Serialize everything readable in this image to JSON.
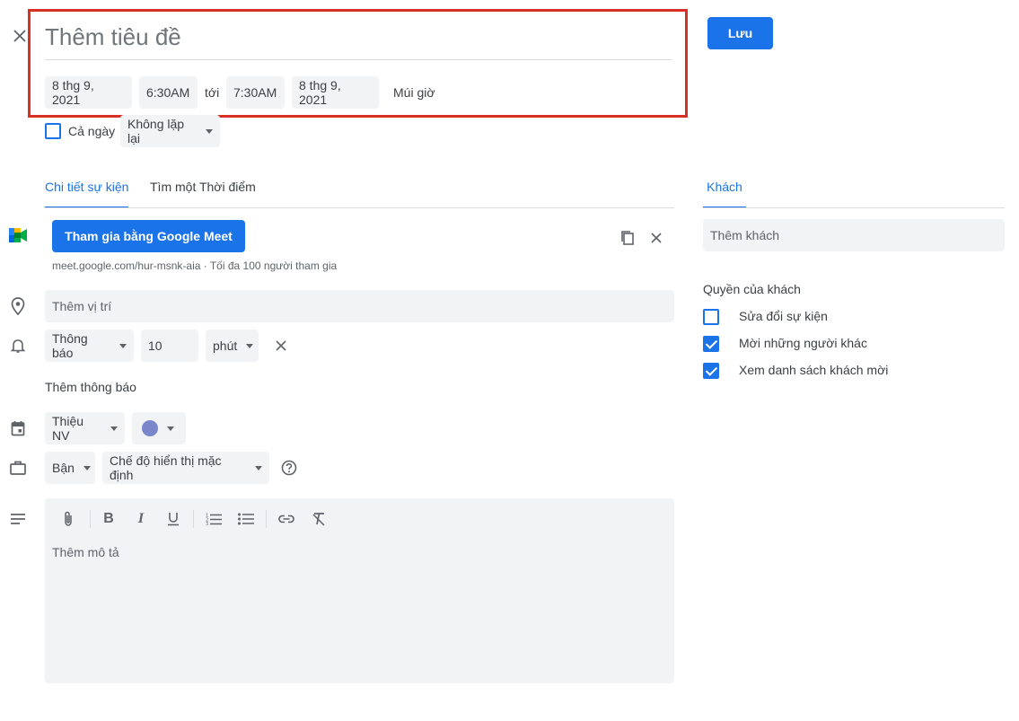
{
  "header": {
    "close_icon": "close-icon",
    "title_placeholder": "Thêm tiêu đề",
    "save_label": "Lưu"
  },
  "datetime": {
    "start_date": "8 thg 9, 2021",
    "start_time": "6:30AM",
    "to_label": "tới",
    "end_time": "7:30AM",
    "end_date": "8 thg 9, 2021",
    "timezone_label": "Múi giờ"
  },
  "options": {
    "all_day_label": "Cả ngày",
    "all_day_checked": false,
    "repeat_value": "Không lặp lại"
  },
  "tabs": {
    "details": "Chi tiết sự kiện",
    "find_time": "Tìm một Thời điểm",
    "active": "details"
  },
  "meet": {
    "join_label": "Tham gia bằng Google Meet",
    "info": "meet.google.com/hur-msnk-aia · Tối đa 100 người tham gia"
  },
  "location": {
    "placeholder": "Thêm vị trí"
  },
  "notification": {
    "type": "Thông báo",
    "amount": "10",
    "unit": "phút",
    "add_label": "Thêm thông báo"
  },
  "calendar": {
    "name": "Thiệu NV",
    "color": "#7986cb"
  },
  "availability": {
    "status": "Bận",
    "visibility": "Chế độ hiển thị mặc định"
  },
  "description": {
    "placeholder": "Thêm mô tả"
  },
  "guests": {
    "tab_label": "Khách",
    "add_placeholder": "Thêm khách",
    "permissions_title": "Quyền của khách",
    "permissions": [
      {
        "label": "Sửa đổi sự kiện",
        "checked": false
      },
      {
        "label": "Mời những người khác",
        "checked": true
      },
      {
        "label": "Xem danh sách khách mời",
        "checked": true
      }
    ]
  },
  "colors": {
    "accent": "#1a73e8",
    "highlight_border": "#d93025"
  }
}
